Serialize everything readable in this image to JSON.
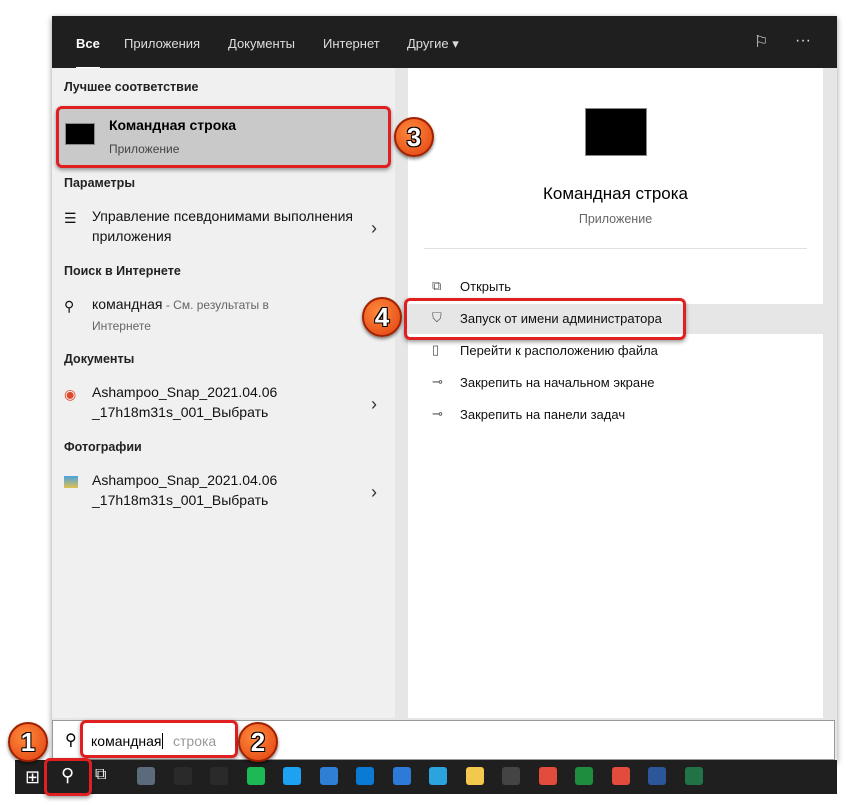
{
  "tabs": [
    "Все",
    "Приложения",
    "Документы",
    "Интернет",
    "Другие ▾"
  ],
  "topbar_icons": [
    "feedback-icon",
    "more-icon"
  ],
  "more_label": "···",
  "left": {
    "best_match_header": "Лучшее соответствие",
    "best_match": {
      "title": "Командная строка",
      "subtitle": "Приложение"
    },
    "settings_header": "Параметры",
    "settings_item": "Управление псевдонимами выполнения приложения",
    "web_header": "Поиск в Интернете",
    "web_item": {
      "query": "командная",
      "suffix": " - См. результаты в Интернете"
    },
    "docs_header": "Документы",
    "doc_item": "Ashampoo_Snap_2021.04.06_17h18m31s_001_Выбрать",
    "photos_header": "Фотографии",
    "photo_item": "Ashampoo_Snap_2021.04.06_17h18m31s_001_Выбрать"
  },
  "right": {
    "title": "Командная строка",
    "subtitle": "Приложение",
    "actions": [
      "Открыть",
      "Запуск от имени администратора",
      "Перейти к расположению файла",
      "Закрепить на начальном экране",
      "Закрепить на панели задач"
    ]
  },
  "search": {
    "typed": "командная",
    "suggestion": "строка"
  },
  "badges": [
    "1",
    "2",
    "3",
    "4"
  ],
  "taskbar_colors": [
    "#5b6b7b",
    "#2a2a2a",
    "#2a2a2a",
    "#1db954",
    "#1da1f2",
    "#2f7fd6",
    "#0a7ad4",
    "#2d7bd6",
    "#2aa3de",
    "#f2c94c",
    "#444",
    "#e34c3c",
    "#1e8e3e",
    "#e34c3c",
    "#2b579a",
    "#217346"
  ],
  "accent": "#e02020"
}
